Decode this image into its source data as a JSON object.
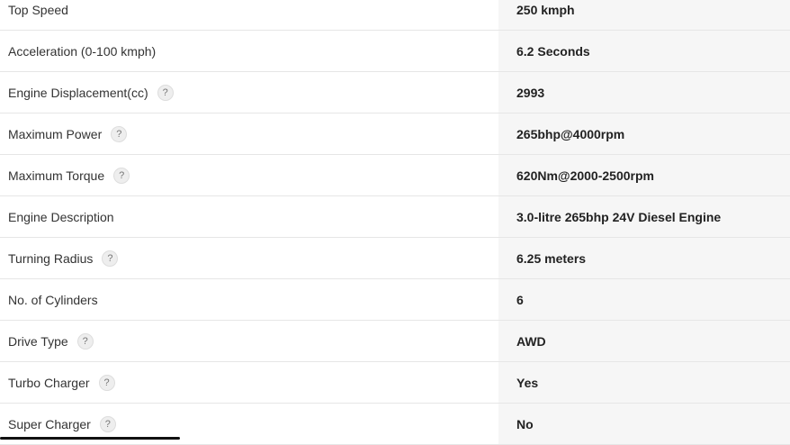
{
  "specs": [
    {
      "label": "Top Speed",
      "value": "250 kmph",
      "help": false
    },
    {
      "label": "Acceleration (0-100 kmph)",
      "value": "6.2 Seconds",
      "help": false
    },
    {
      "label": "Engine Displacement(cc)",
      "value": "2993",
      "help": true
    },
    {
      "label": "Maximum Power",
      "value": "265bhp@4000rpm",
      "help": true
    },
    {
      "label": "Maximum Torque",
      "value": "620Nm@2000-2500rpm",
      "help": true
    },
    {
      "label": "Engine Description",
      "value": "3.0-litre 265bhp 24V Diesel Engine",
      "help": false
    },
    {
      "label": "Turning Radius",
      "value": "6.25 meters",
      "help": true
    },
    {
      "label": "No. of Cylinders",
      "value": "6",
      "help": false
    },
    {
      "label": "Drive Type",
      "value": "AWD",
      "help": true
    },
    {
      "label": "Turbo Charger",
      "value": "Yes",
      "help": true
    },
    {
      "label": "Super Charger",
      "value": "No",
      "help": true
    }
  ],
  "help_glyph": "?",
  "icons": {
    "help": "help-icon"
  }
}
